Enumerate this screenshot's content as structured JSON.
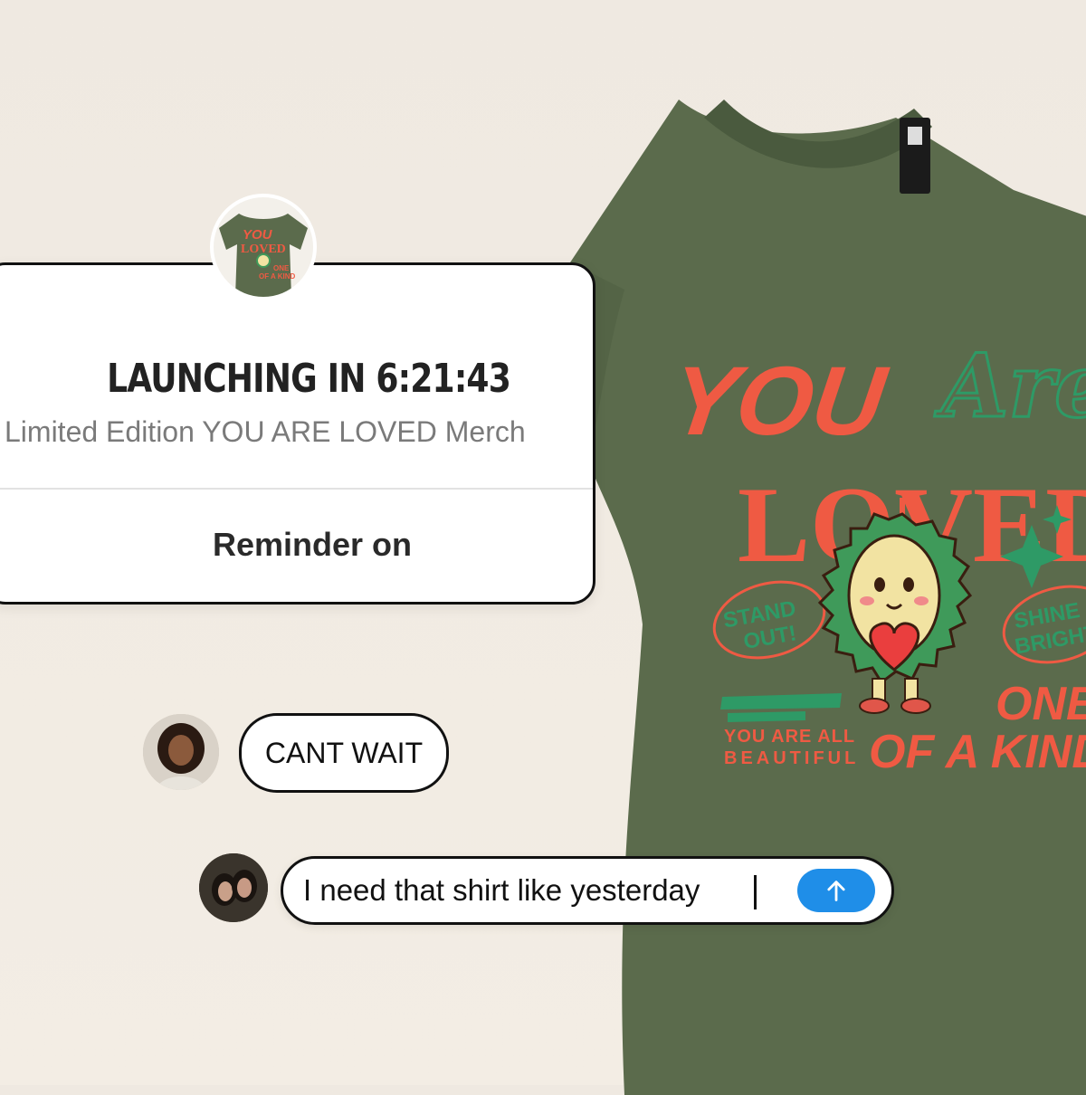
{
  "story": {
    "countdown_title": "LAUNCHING IN 6:21:43",
    "subtitle": "Limited Edition YOU ARE LOVED Merch",
    "reminder_label": "Reminder on"
  },
  "shirt_print": {
    "you": "YOU",
    "are": "Are",
    "loved": "LOVED",
    "stand_out": [
      "STAND",
      "OUT!"
    ],
    "shine_bright": [
      "SHINE",
      "BRIGHT"
    ],
    "all_beautiful": [
      "YOU ARE ALL",
      "BEAUTIFUL"
    ],
    "one": "ONE",
    "of_a_kind": "OF A KIND"
  },
  "thumb_print": {
    "you": "YOU",
    "loved": "LOVED",
    "one": "ONE",
    "of_a_kind": "OF A KIND"
  },
  "chat": {
    "comment_1": "CANT WAIT",
    "input_value": "I need that shirt like yesterday"
  },
  "colors": {
    "shirt": "#5b6b4c",
    "print_red": "#ef5a43",
    "print_green": "#2e9a66",
    "send": "#1f8ee8"
  },
  "icons": {
    "send": "arrow-up-icon"
  }
}
